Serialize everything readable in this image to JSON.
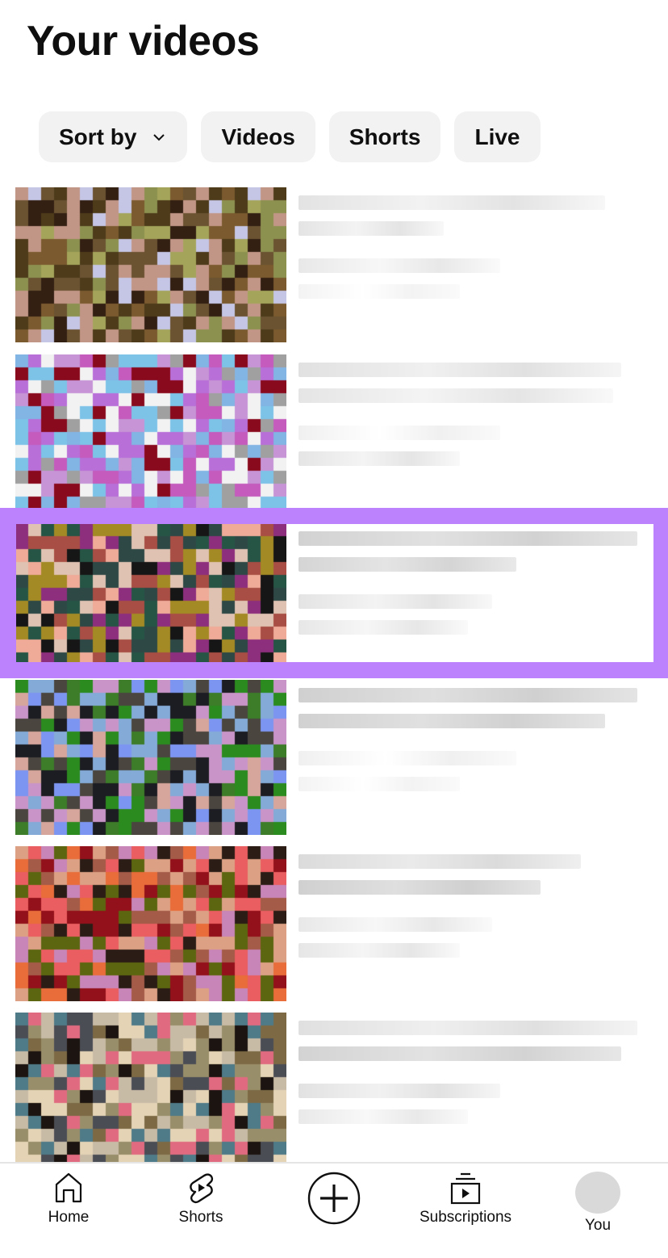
{
  "page": {
    "title": "Your videos"
  },
  "filters": {
    "sort_label": "Sort by",
    "chips": [
      "Videos",
      "Shorts",
      "Live"
    ]
  },
  "videos": [
    {
      "thumbnail_colors": [
        "#6b5332",
        "#4d3b1a",
        "#8c9150",
        "#c29686",
        "#c5c6e6",
        "#7a5a2e",
        "#a4a55a",
        "#332013"
      ],
      "title_obscured": true,
      "selected": false
    },
    {
      "thumbnail_colors": [
        "#f2f2f2",
        "#c794d6",
        "#7dc3e8",
        "#b86fd8",
        "#8a0a1d",
        "#c45bbd",
        "#82b4e4",
        "#a0a0a0"
      ],
      "title_obscured": true,
      "selected": false
    },
    {
      "thumbnail_colors": [
        "#2e4846",
        "#a84e44",
        "#8e2f7e",
        "#efaa98",
        "#265546",
        "#dfc2b1",
        "#a48a24",
        "#161616"
      ],
      "title_obscured": true,
      "selected": true
    },
    {
      "thumbnail_colors": [
        "#4a463f",
        "#c995c8",
        "#d6a59c",
        "#3d7c29",
        "#2b8b1f",
        "#7c95f0",
        "#1c1d22",
        "#84aad8"
      ],
      "title_obscured": true,
      "selected": false
    },
    {
      "thumbnail_colors": [
        "#ea5d60",
        "#92111a",
        "#5c6610",
        "#c885b7",
        "#e86d3a",
        "#dca184",
        "#2b1d16",
        "#a45b48"
      ],
      "title_obscured": true,
      "selected": false
    },
    {
      "thumbnail_colors": [
        "#998e6a",
        "#7d6a45",
        "#4f7a88",
        "#e06b80",
        "#c8bba6",
        "#1c1410",
        "#e4d4b5",
        "#4b4d55"
      ],
      "title_obscured": true,
      "selected": false
    }
  ],
  "highlight": {
    "color": "#bc82fe",
    "index": 2
  },
  "bottom_nav": {
    "items": [
      {
        "label": "Home",
        "icon": "home-icon"
      },
      {
        "label": "Shorts",
        "icon": "shorts-icon"
      },
      {
        "label": "",
        "icon": "create-plus-icon"
      },
      {
        "label": "Subscriptions",
        "icon": "subscriptions-icon"
      },
      {
        "label": "You",
        "icon": "avatar"
      }
    ]
  }
}
